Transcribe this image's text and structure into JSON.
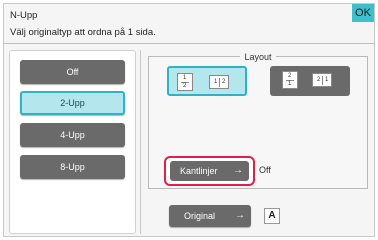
{
  "header": {
    "title": "N-Upp",
    "subtitle": "Välj originaltyp att ordna på 1 sida.",
    "ok_label": "OK"
  },
  "options": [
    {
      "label": "Off",
      "selected": false
    },
    {
      "label": "2-Upp",
      "selected": true
    },
    {
      "label": "4-Upp",
      "selected": false
    },
    {
      "label": "8-Upp",
      "selected": false
    }
  ],
  "layout": {
    "label": "Layout",
    "option_a": {
      "p1": "1",
      "p2": "2"
    },
    "option_b": {
      "p1": "2",
      "p2": "1"
    }
  },
  "kantlinjer": {
    "label": "Kantlinjer",
    "arrow": "→",
    "state": "Off"
  },
  "original": {
    "label": "Original",
    "arrow": "→",
    "icon_letter": "A"
  },
  "colors": {
    "accent": "#3ec0cc",
    "selected_bg": "#b4e6ee",
    "button_gray": "#6a6a6a",
    "highlight_red": "#e0204c"
  }
}
